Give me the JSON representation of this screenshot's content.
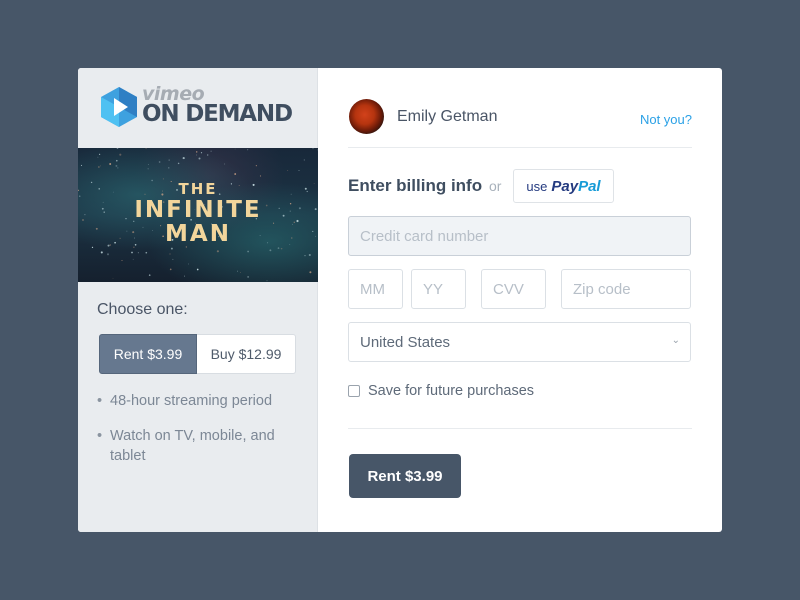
{
  "brand": {
    "logo_word_top": "vimeo",
    "logo_word_bottom": "ON DEMAND",
    "logo_icon": "play-hexagon-icon",
    "accent_blue": "#2ba1e6",
    "dark_slate": "#475668"
  },
  "film": {
    "title_line1": "THE",
    "title_line2": "INFINITE",
    "title_line3": "MAN"
  },
  "purchase_options": {
    "label": "Choose one:",
    "options": [
      {
        "label": "Rent $3.99",
        "selected": true
      },
      {
        "label": "Buy $12.99",
        "selected": false
      }
    ],
    "features": [
      "48-hour streaming period",
      "Watch on TV, mobile, and tablet"
    ],
    "bullet": "•"
  },
  "user": {
    "name": "Emily Getman",
    "not_you_link": "Not you?"
  },
  "billing": {
    "title": "Enter billing info",
    "or_text": "or",
    "paypal": {
      "use": "use",
      "pay": "Pay",
      "pal": "Pal"
    },
    "fields": {
      "card_number": {
        "placeholder": "Credit card number",
        "value": ""
      },
      "month": {
        "placeholder": "MM",
        "value": ""
      },
      "year": {
        "placeholder": "YY",
        "value": ""
      },
      "cvv": {
        "placeholder": "CVV",
        "value": ""
      },
      "zip": {
        "placeholder": "Zip code",
        "value": ""
      }
    },
    "country": {
      "selected": "United States",
      "chevron": "⌄"
    },
    "save_checkbox": {
      "label": "Save for future purchases",
      "checked": false
    },
    "submit_label": "Rent $3.99"
  }
}
